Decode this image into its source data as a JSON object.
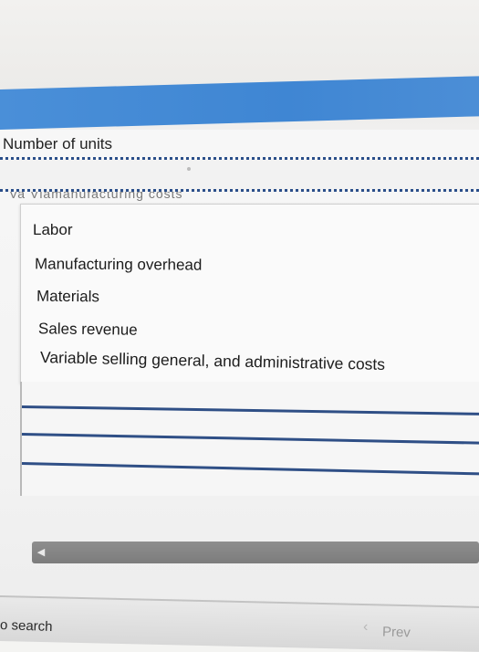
{
  "table": {
    "units_label": "Number of units",
    "dropdown_header_partial": "Va   Vlamanufacturing costs"
  },
  "dropdown": {
    "options": [
      "Labor",
      "Manufacturing overhead",
      "Materials",
      "Sales revenue",
      "Variable selling general, and administrative costs"
    ]
  },
  "footer": {
    "search_label": "o search",
    "prev_label": "Prev",
    "prev_icon": "chevron-left-icon"
  },
  "colors": {
    "header_bar": "#4a8fd8",
    "row_border": "#2f4f86"
  }
}
